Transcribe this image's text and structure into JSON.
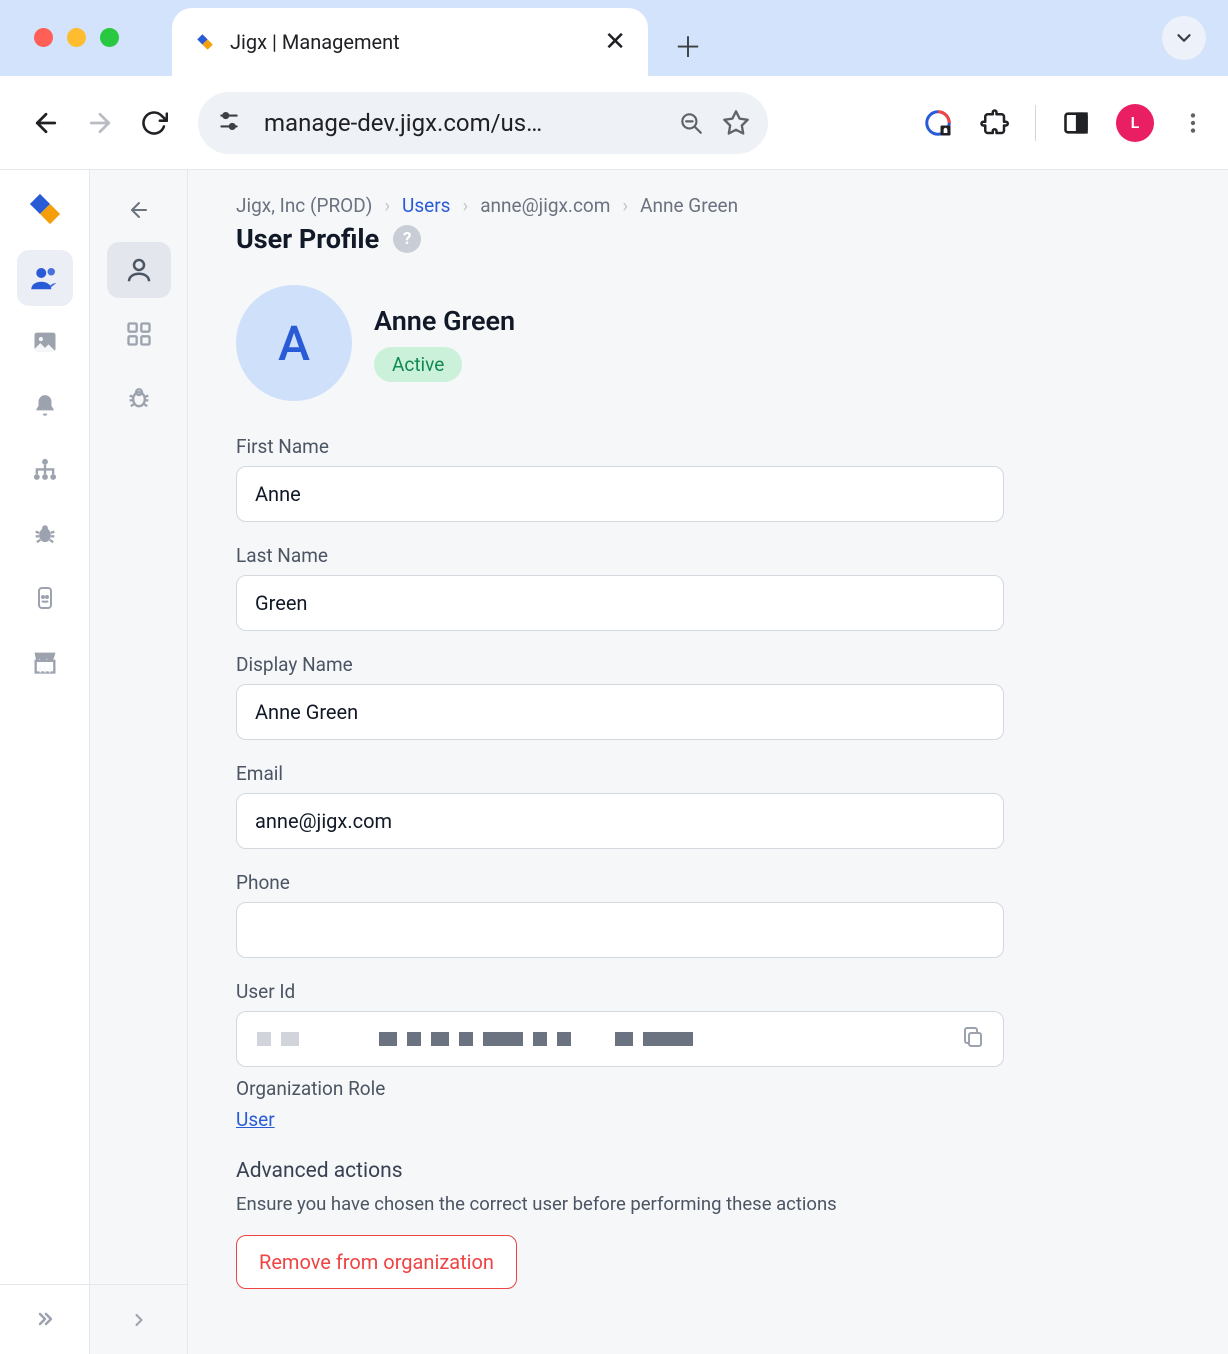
{
  "browser": {
    "tab_title": "Jigx | Management",
    "url_display": "manage-dev.jigx.com/us…",
    "profile_initial": "L"
  },
  "breadcrumb": {
    "org": "Jigx, Inc (PROD)",
    "users_label": "Users",
    "email": "anne@jigx.com",
    "name": "Anne Green"
  },
  "page": {
    "title": "User Profile"
  },
  "profile": {
    "avatar_initial": "A",
    "display_name_header": "Anne Green",
    "status": "Active"
  },
  "form": {
    "first_name_label": "First Name",
    "first_name_value": "Anne",
    "last_name_label": "Last Name",
    "last_name_value": "Green",
    "display_name_label": "Display Name",
    "display_name_value": "Anne Green",
    "email_label": "Email",
    "email_value": "anne@jigx.com",
    "phone_label": "Phone",
    "phone_value": "",
    "user_id_label": "User Id",
    "org_role_label": "Organization Role",
    "org_role_value": "User"
  },
  "advanced": {
    "title": "Advanced actions",
    "note": "Ensure you have chosen the correct user before performing these actions",
    "remove_label": "Remove from organization"
  }
}
